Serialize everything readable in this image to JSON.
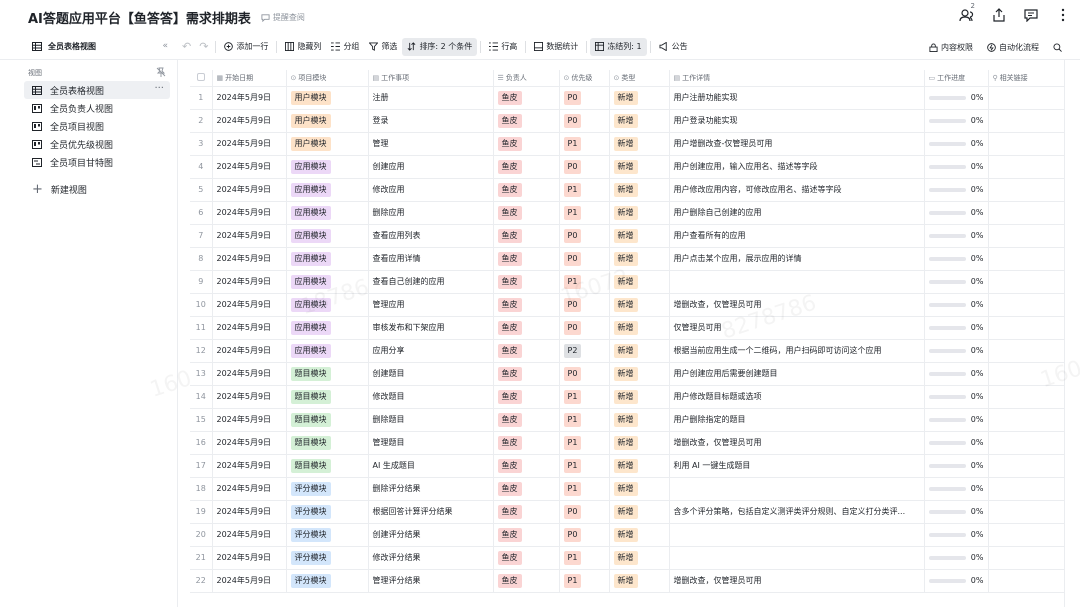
{
  "app": {
    "title": "AI答题应用平台【鱼答答】需求排期表",
    "reminder_label": "提醒查阅",
    "notify_count": "2"
  },
  "toolbar": {
    "view_name": "全员表格视图",
    "collapse_glyph": "«",
    "add_row": "添加一行",
    "hide_columns": "隐藏列",
    "group": "分组",
    "filter": "筛选",
    "sort": "排序: 2 个条件",
    "row_height": "行高",
    "stats": "数据统计",
    "freeze": "冻结列: 1",
    "notice": "公告",
    "permission": "内容权限",
    "automation": "自动化流程"
  },
  "sidebar": {
    "heading": "视图",
    "items": [
      {
        "label": "全员表格视图",
        "icon": "table-icon"
      },
      {
        "label": "全员负责人视图",
        "icon": "kanban-icon"
      },
      {
        "label": "全员项目视图",
        "icon": "kanban-icon"
      },
      {
        "label": "全员优先级视图",
        "icon": "kanban-icon"
      },
      {
        "label": "全员项目甘特图",
        "icon": "gantt-icon"
      }
    ],
    "more_glyph": "···",
    "new_view": "新建视图"
  },
  "columns": {
    "start_date": "开始日期",
    "module": "项目模块",
    "task": "工作事项",
    "owner": "负责人",
    "priority": "优先级",
    "type": "类型",
    "detail": "工作详情",
    "progress": "工作进度",
    "link": "相关链接"
  },
  "rows": [
    {
      "idx": "1",
      "date": "2024年5月9日",
      "module": "用户模块",
      "mclass": "t-user",
      "task": "注册",
      "owner": "鱼皮",
      "priority": "P0",
      "type": "新增",
      "detail": "用户注册功能实现",
      "progress": "0%",
      "progress_value": 0
    },
    {
      "idx": "2",
      "date": "2024年5月9日",
      "module": "用户模块",
      "mclass": "t-user",
      "task": "登录",
      "owner": "鱼皮",
      "priority": "P0",
      "type": "新增",
      "detail": "用户登录功能实现",
      "progress": "0%",
      "progress_value": 0
    },
    {
      "idx": "3",
      "date": "2024年5月9日",
      "module": "用户模块",
      "mclass": "t-user",
      "task": "管理",
      "owner": "鱼皮",
      "priority": "P1",
      "type": "新增",
      "detail": "用户增删改查-仅管理员可用",
      "progress": "0%",
      "progress_value": 0
    },
    {
      "idx": "4",
      "date": "2024年5月9日",
      "module": "应用模块",
      "mclass": "t-app",
      "task": "创建应用",
      "owner": "鱼皮",
      "priority": "P0",
      "type": "新增",
      "detail": "用户创建应用，输入应用名、描述等字段",
      "progress": "0%",
      "progress_value": 0
    },
    {
      "idx": "5",
      "date": "2024年5月9日",
      "module": "应用模块",
      "mclass": "t-app",
      "task": "修改应用",
      "owner": "鱼皮",
      "priority": "P1",
      "type": "新增",
      "detail": "用户修改应用内容，可修改应用名、描述等字段",
      "progress": "0%",
      "progress_value": 0
    },
    {
      "idx": "6",
      "date": "2024年5月9日",
      "module": "应用模块",
      "mclass": "t-app",
      "task": "删除应用",
      "owner": "鱼皮",
      "priority": "P1",
      "type": "新增",
      "detail": "用户删除自己创建的应用",
      "progress": "0%",
      "progress_value": 0
    },
    {
      "idx": "7",
      "date": "2024年5月9日",
      "module": "应用模块",
      "mclass": "t-app",
      "task": "查看应用列表",
      "owner": "鱼皮",
      "priority": "P0",
      "type": "新增",
      "detail": "用户查看所有的应用",
      "progress": "0%",
      "progress_value": 0
    },
    {
      "idx": "8",
      "date": "2024年5月9日",
      "module": "应用模块",
      "mclass": "t-app",
      "task": "查看应用详情",
      "owner": "鱼皮",
      "priority": "P0",
      "type": "新增",
      "detail": "用户点击某个应用，展示应用的详情",
      "progress": "0%",
      "progress_value": 0
    },
    {
      "idx": "9",
      "date": "2024年5月9日",
      "module": "应用模块",
      "mclass": "t-app",
      "task": "查看自己创建的应用",
      "owner": "鱼皮",
      "priority": "P1",
      "type": "新增",
      "detail": "",
      "progress": "0%",
      "progress_value": 0
    },
    {
      "idx": "10",
      "date": "2024年5月9日",
      "module": "应用模块",
      "mclass": "t-app",
      "task": "管理应用",
      "owner": "鱼皮",
      "priority": "P0",
      "type": "新增",
      "detail": "增删改查，仅管理员可用",
      "progress": "0%",
      "progress_value": 0
    },
    {
      "idx": "11",
      "date": "2024年5月9日",
      "module": "应用模块",
      "mclass": "t-app",
      "task": "审核发布和下架应用",
      "owner": "鱼皮",
      "priority": "P0",
      "type": "新增",
      "detail": "仅管理员可用",
      "progress": "0%",
      "progress_value": 0
    },
    {
      "idx": "12",
      "date": "2024年5月9日",
      "module": "应用模块",
      "mclass": "t-app",
      "task": "应用分享",
      "owner": "鱼皮",
      "priority": "P2",
      "type": "新增",
      "detail": "根据当前应用生成一个二维码，用户扫码即可访问这个应用",
      "progress": "0%",
      "progress_value": 0
    },
    {
      "idx": "13",
      "date": "2024年5月9日",
      "module": "题目模块",
      "mclass": "t-q",
      "task": "创建题目",
      "owner": "鱼皮",
      "priority": "P0",
      "type": "新增",
      "detail": "用户创建应用后需要创建题目",
      "progress": "0%",
      "progress_value": 0
    },
    {
      "idx": "14",
      "date": "2024年5月9日",
      "module": "题目模块",
      "mclass": "t-q",
      "task": "修改题目",
      "owner": "鱼皮",
      "priority": "P1",
      "type": "新增",
      "detail": "用户修改题目标题或选项",
      "progress": "0%",
      "progress_value": 0
    },
    {
      "idx": "15",
      "date": "2024年5月9日",
      "module": "题目模块",
      "mclass": "t-q",
      "task": "删除题目",
      "owner": "鱼皮",
      "priority": "P1",
      "type": "新增",
      "detail": "用户删除指定的题目",
      "progress": "0%",
      "progress_value": 0
    },
    {
      "idx": "16",
      "date": "2024年5月9日",
      "module": "题目模块",
      "mclass": "t-q",
      "task": "管理题目",
      "owner": "鱼皮",
      "priority": "P1",
      "type": "新增",
      "detail": "增删改查，仅管理员可用",
      "progress": "0%",
      "progress_value": 0
    },
    {
      "idx": "17",
      "date": "2024年5月9日",
      "module": "题目模块",
      "mclass": "t-q",
      "task": "AI 生成题目",
      "owner": "鱼皮",
      "priority": "P1",
      "type": "新增",
      "detail": "利用 AI 一键生成题目",
      "progress": "0%",
      "progress_value": 0
    },
    {
      "idx": "18",
      "date": "2024年5月9日",
      "module": "评分模块",
      "mclass": "t-score",
      "task": "删除评分结果",
      "owner": "鱼皮",
      "priority": "P1",
      "type": "新增",
      "detail": "",
      "progress": "0%",
      "progress_value": 0
    },
    {
      "idx": "19",
      "date": "2024年5月9日",
      "module": "评分模块",
      "mclass": "t-score",
      "task": "根据回答计算评分结果",
      "owner": "鱼皮",
      "priority": "P0",
      "type": "新增",
      "detail": "含多个评分策略，包括自定义测评类评分规则、自定义打分类评...",
      "progress": "0%",
      "progress_value": 0
    },
    {
      "idx": "20",
      "date": "2024年5月9日",
      "module": "评分模块",
      "mclass": "t-score",
      "task": "创建评分结果",
      "owner": "鱼皮",
      "priority": "P0",
      "type": "新增",
      "detail": "",
      "progress": "0%",
      "progress_value": 0
    },
    {
      "idx": "21",
      "date": "2024年5月9日",
      "module": "评分模块",
      "mclass": "t-score",
      "task": "修改评分结果",
      "owner": "鱼皮",
      "priority": "P1",
      "type": "新增",
      "detail": "",
      "progress": "0%",
      "progress_value": 0
    },
    {
      "idx": "22",
      "date": "2024年5月9日",
      "module": "评分模块",
      "mclass": "t-score",
      "task": "管理评分结果",
      "owner": "鱼皮",
      "priority": "P1",
      "type": "新增",
      "detail": "增删改查，仅管理员可用",
      "progress": "0%",
      "progress_value": 0
    }
  ],
  "watermarks": [
    "18786",
    "16072",
    "8278786",
    "160",
    "1607"
  ],
  "colors": {
    "accent": "#3370ff",
    "user_module": "#fde2c8",
    "app_module": "#ecd8f7",
    "question_module": "#d4f0d6",
    "score_module": "#d3e6fb",
    "owner_tag": "#fad4d4",
    "priority_tag": "#fcd8cf",
    "type_tag": "#fde6cc"
  }
}
